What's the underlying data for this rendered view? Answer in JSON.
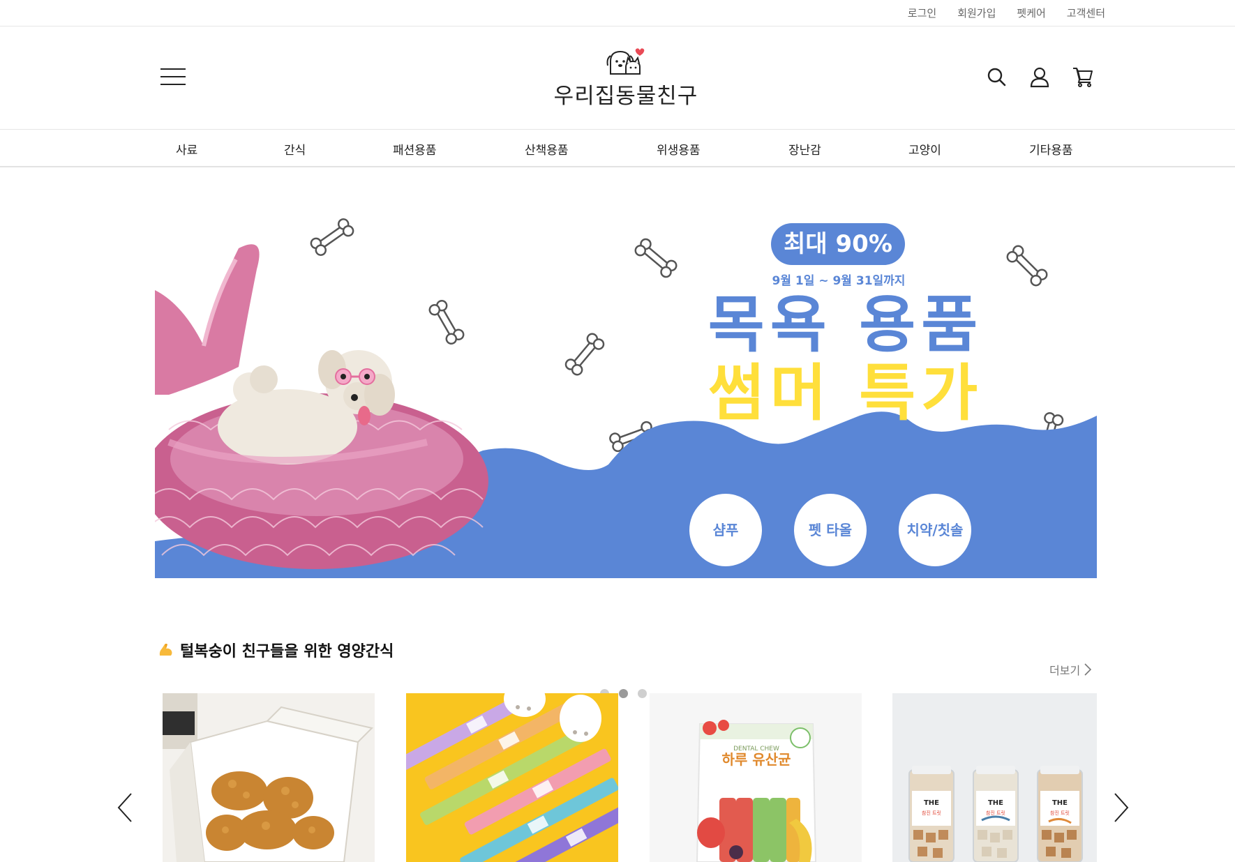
{
  "top_links": [
    "로그인",
    "회원가입",
    "펫케어",
    "고객센터"
  ],
  "logo_text": "우리집동물친구",
  "header_icons": [
    "search-icon",
    "user-icon",
    "cart-icon"
  ],
  "nav_items": [
    "사료",
    "간식",
    "패션용품",
    "산책용품",
    "위생용품",
    "장난감",
    "고양이",
    "기타용품"
  ],
  "banner": {
    "badge": "최대 90%",
    "period": "9월 1일 ~ 9월 31일까지",
    "headline_line1": "목욕 용품",
    "headline_line2": "썸머 특가",
    "categories": [
      "샴푸",
      "펫 타올",
      "치약/칫솔"
    ],
    "colors": {
      "blue": "#5a86d6",
      "yellow": "#ffdf3b",
      "pink": "#c9608f"
    }
  },
  "section": {
    "title": "털복숭이 친구들을 위한 영양간식",
    "title_icon": "flexed-arm-icon",
    "more_label": "더보기",
    "carousel_dots": 3,
    "active_dot": 1
  },
  "products": [
    {
      "image": "fried-chicken-box"
    },
    {
      "image": "colorful-stick-treats"
    },
    {
      "image": "dental-chew-pack",
      "pack_title": "하루 유산균",
      "pack_subtitle": "DENTAL CHEW"
    },
    {
      "image": "treat-jars",
      "jar_label": "THE",
      "jar_sub": "참진 트릿"
    }
  ]
}
